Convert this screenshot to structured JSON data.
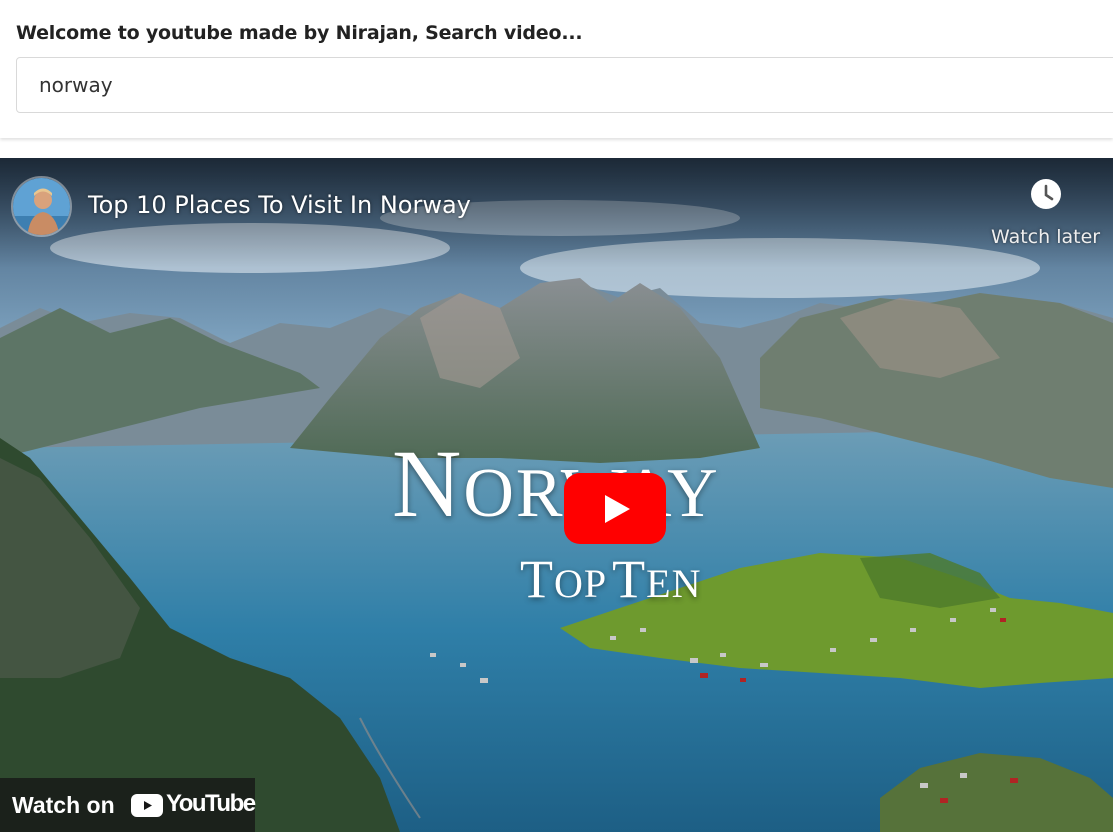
{
  "header": {
    "title": "Welcome to youtube made by Nirajan, Search video...",
    "search_value": "norway"
  },
  "player": {
    "video_title": "Top 10 Places To Visit In Norway",
    "watch_later_label": "Watch later",
    "overlay_title_first": "N",
    "overlay_title_rest": "ORWAY",
    "overlay_sub_t1": "T",
    "overlay_sub_op": "OP",
    "overlay_sub_t2": "T",
    "overlay_sub_en": "EN",
    "watch_on_label": "Watch on",
    "brand_label": "YouTube"
  },
  "colors": {
    "play_red": "#ff0000",
    "water": "#2f7fa8",
    "grass": "#6e9a2e"
  },
  "icons": [
    "clock-icon",
    "play-icon",
    "youtube-logo-icon"
  ]
}
